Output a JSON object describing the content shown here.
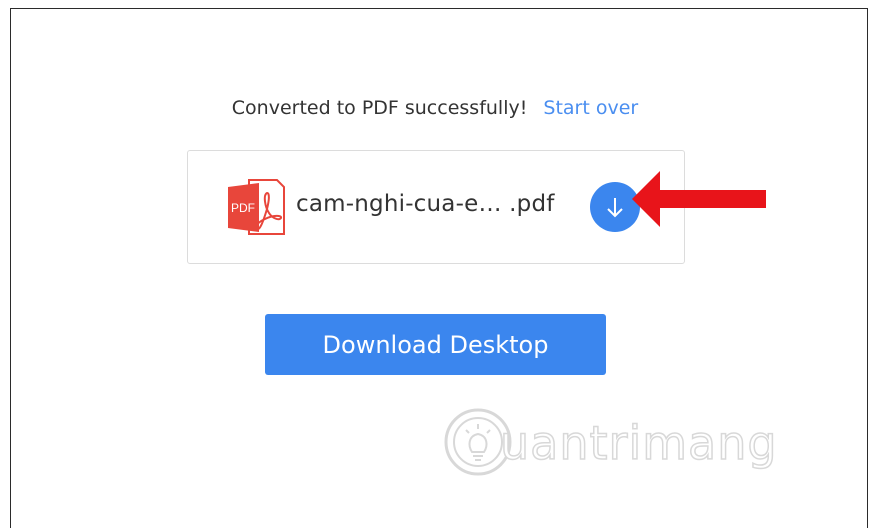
{
  "status": {
    "message": "Converted to PDF successfully!",
    "start_over_label": "Start over"
  },
  "file": {
    "icon_label": "PDF",
    "name": "cam-nghi-cua-e… .pdf"
  },
  "actions": {
    "download_desktop_label": "Download Desktop"
  },
  "watermark": {
    "text": "uantrimang"
  },
  "colors": {
    "accent": "#3b86ee",
    "link": "#4a8ef0",
    "pdf_red": "#e8463b",
    "annotation_arrow": "#e8141a"
  },
  "icons": {
    "file_icon": "pdf-file-icon",
    "download": "arrow-down-icon",
    "annotation": "red-arrow-icon",
    "watermark_logo": "lightbulb-icon"
  }
}
